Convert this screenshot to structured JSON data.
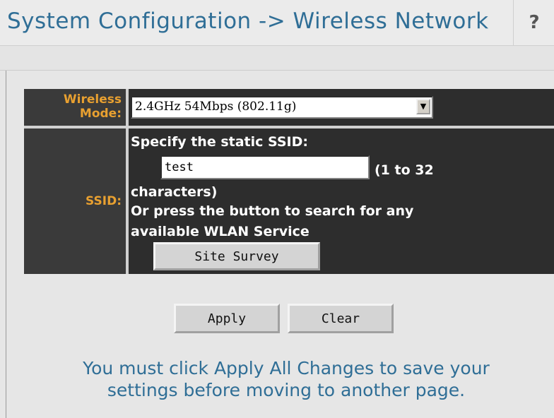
{
  "header": {
    "title": "System Configuration -> Wireless Network",
    "help_label": "?"
  },
  "form": {
    "wireless_mode": {
      "label_line1": "Wireless",
      "label_line2": "Mode:",
      "selected": "2.4GHz 54Mbps (802.11g)"
    },
    "ssid": {
      "label": "SSID:",
      "specify_text": "Specify the static SSID:",
      "value": "test",
      "range_hint": "(1 to 32",
      "range_hint_cont": "characters)",
      "search_line1": "Or press the button to search for any",
      "search_line2": "available WLAN Service",
      "site_survey_label": "Site Survey"
    }
  },
  "actions": {
    "apply_label": "Apply",
    "clear_label": "Clear"
  },
  "notice": {
    "line1": "You must click Apply All Changes to save your",
    "line2": "settings before moving to another page."
  },
  "colors": {
    "title": "#2f6e96",
    "label": "#e8a030",
    "table_bg": "#2d2d2d"
  }
}
